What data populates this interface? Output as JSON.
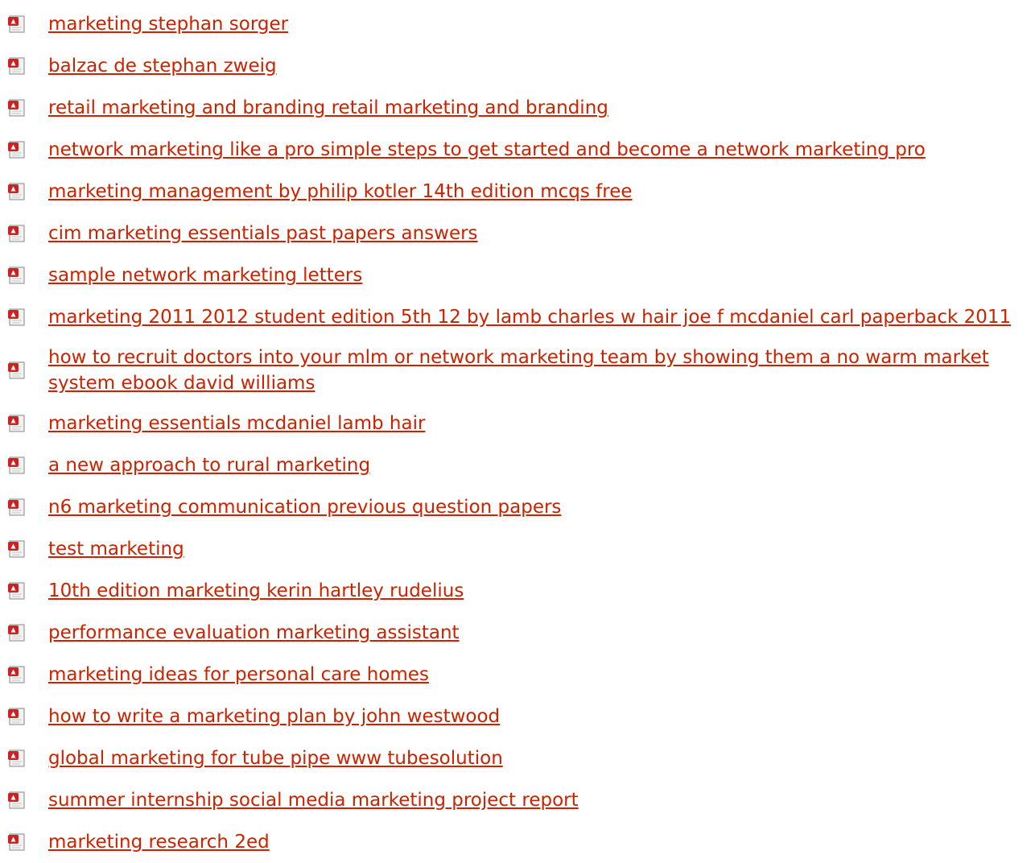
{
  "colors": {
    "link": "#cc2200",
    "icon_page": "#f2f2f2",
    "icon_border": "#9a9a9a",
    "icon_badge": "#d21f1f"
  },
  "icon": "pdf-file-icon",
  "links": [
    {
      "label": "marketing stephan sorger"
    },
    {
      "label": "balzac de stephan zweig"
    },
    {
      "label": "retail marketing and branding retail marketing and branding"
    },
    {
      "label": "network marketing like a pro simple steps to get started and become a network marketing pro"
    },
    {
      "label": "marketing management by philip kotler 14th edition mcqs free"
    },
    {
      "label": "cim marketing essentials past papers answers"
    },
    {
      "label": "sample network marketing letters"
    },
    {
      "label": "marketing 2011 2012 student edition 5th 12 by lamb charles w hair joe f mcdaniel carl paperback 2011"
    },
    {
      "label": "how to recruit doctors into your mlm or network marketing team by showing them a no warm market system ebook david williams"
    },
    {
      "label": "marketing essentials mcdaniel lamb hair"
    },
    {
      "label": "a new approach to rural marketing"
    },
    {
      "label": "n6 marketing communication previous question papers"
    },
    {
      "label": "test marketing"
    },
    {
      "label": "10th edition marketing kerin hartley rudelius"
    },
    {
      "label": "performance evaluation marketing assistant"
    },
    {
      "label": "marketing ideas for personal care homes"
    },
    {
      "label": "how to write a marketing plan by john westwood"
    },
    {
      "label": "global marketing for tube pipe www tubesolution"
    },
    {
      "label": "summer internship social media marketing project report"
    },
    {
      "label": "marketing research 2ed"
    }
  ]
}
